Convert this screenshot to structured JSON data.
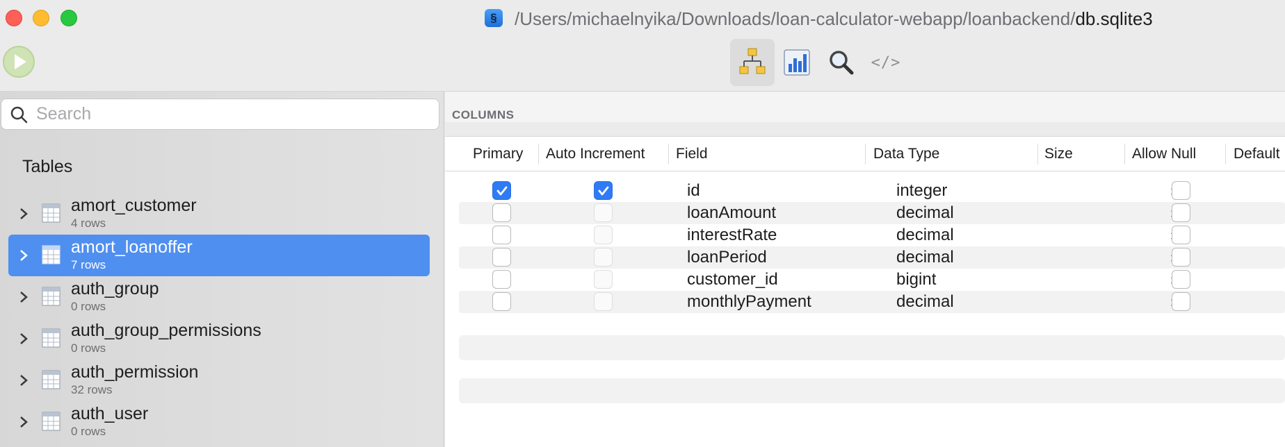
{
  "window": {
    "path_prefix": "/Users/michaelnyika/Downloads/loan-calculator-webapp/loanbackend/",
    "file_name": "db.sqlite3"
  },
  "toolbar": {
    "run_icon": "play-icon",
    "buttons": [
      {
        "icon": "structure-tree-icon",
        "active": true
      },
      {
        "icon": "bar-chart-icon",
        "active": false
      },
      {
        "icon": "magnifier-icon",
        "active": false
      },
      {
        "icon": "code-icon",
        "label": "</>",
        "active": false
      }
    ]
  },
  "sidebar": {
    "search_placeholder": "Search",
    "tables_heading": "Tables",
    "tables": [
      {
        "name": "amort_customer",
        "rows": "4 rows",
        "selected": false
      },
      {
        "name": "amort_loanoffer",
        "rows": "7 rows",
        "selected": true
      },
      {
        "name": "auth_group",
        "rows": "0 rows",
        "selected": false
      },
      {
        "name": "auth_group_permissions",
        "rows": "0 rows",
        "selected": false
      },
      {
        "name": "auth_permission",
        "rows": "32 rows",
        "selected": false
      },
      {
        "name": "auth_user",
        "rows": "0 rows",
        "selected": false
      }
    ]
  },
  "main": {
    "section_title": "COLUMNS",
    "headers": {
      "primary": "Primary",
      "auto_increment": "Auto Increment",
      "field": "Field",
      "data_type": "Data Type",
      "size": "Size",
      "allow_null": "Allow Null",
      "default": "Default"
    },
    "columns": [
      {
        "field": "id",
        "type": "integer",
        "primary": true,
        "auto_increment": true,
        "allow_null": false
      },
      {
        "field": "loanAmount",
        "type": "decimal",
        "primary": false,
        "auto_increment": false,
        "allow_null": false
      },
      {
        "field": "interestRate",
        "type": "decimal",
        "primary": false,
        "auto_increment": false,
        "allow_null": false
      },
      {
        "field": "loanPeriod",
        "type": "decimal",
        "primary": false,
        "auto_increment": false,
        "allow_null": false
      },
      {
        "field": "customer_id",
        "type": "bigint",
        "primary": false,
        "auto_increment": false,
        "allow_null": false
      },
      {
        "field": "monthlyPayment",
        "type": "decimal",
        "primary": false,
        "auto_increment": false,
        "allow_null": false
      }
    ]
  },
  "colors": {
    "selection": "#4f8ff0",
    "checkbox_checked": "#2f7bf5"
  }
}
